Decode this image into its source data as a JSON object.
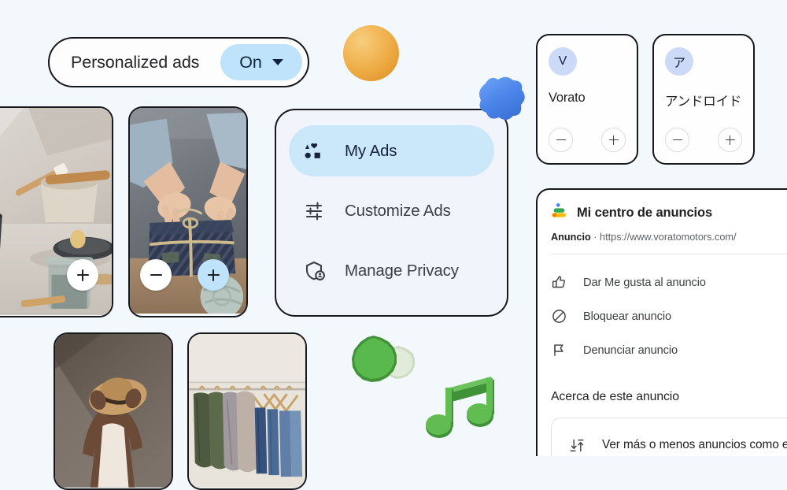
{
  "theme": {
    "background": "#f3f8fc",
    "outline": "#17181c",
    "accent_blue": "#bfe3fb",
    "nav_panel_bg": "#f2f4fc",
    "nav_active_bg": "#cbe8fb",
    "brand_avatar_bg": "#ccd9f7"
  },
  "personalized_ads": {
    "label": "Personalized ads",
    "value": "On",
    "dropdown_icon": "chevron-down-icon"
  },
  "nav": {
    "items": [
      {
        "label": "My Ads",
        "icon": "shapes-grid-icon",
        "active": true
      },
      {
        "label": "Customize Ads",
        "icon": "sliders-icon",
        "active": false
      },
      {
        "label": "Manage Privacy",
        "icon": "shield-lock-icon",
        "active": false
      }
    ]
  },
  "photo_cards": [
    {
      "name": "bathroom-still-life",
      "minus_label": "−",
      "plus_label": "+",
      "plus_selected": false
    },
    {
      "name": "gift-wrapping-hands",
      "minus_label": "−",
      "plus_label": "+",
      "plus_selected": true
    },
    {
      "name": "woman-with-hat",
      "minus_label": "−",
      "plus_label": "+",
      "plus_selected": false
    },
    {
      "name": "clothing-rack",
      "minus_label": "−",
      "plus_label": "+",
      "plus_selected": false
    }
  ],
  "brand_cards": [
    {
      "avatar_letter": "V",
      "name": "Vorato",
      "decrease_label": "−",
      "increase_label": "+"
    },
    {
      "avatar_letter": "ア",
      "name": "アンドロイド",
      "decrease_label": "−",
      "increase_label": "+"
    }
  ],
  "ad_panel": {
    "title": "Mi centro de anuncios",
    "title_icon": "google-ads-icon",
    "ad_label": "Anuncio",
    "separator": "·",
    "url": "https://www.voratomotors.com/",
    "actions": [
      {
        "label": "Dar Me gusta al anuncio",
        "icon": "thumb-up-icon"
      },
      {
        "label": "Bloquear anuncio",
        "icon": "block-icon"
      },
      {
        "label": "Denunciar anuncio",
        "icon": "flag-icon"
      }
    ],
    "section_title": "Acerca de este anuncio",
    "sub_action": {
      "label": "Ver más o menos anuncios como este",
      "icon": "tune-more-less-icon"
    }
  },
  "decorations": [
    {
      "name": "orange-sphere",
      "color": "#eda942"
    },
    {
      "name": "blue-blob",
      "color": "#4f8df0"
    },
    {
      "name": "green-scallop-pair",
      "color": "#4fb045"
    },
    {
      "name": "green-music-note",
      "color": "#5cb84e"
    }
  ]
}
